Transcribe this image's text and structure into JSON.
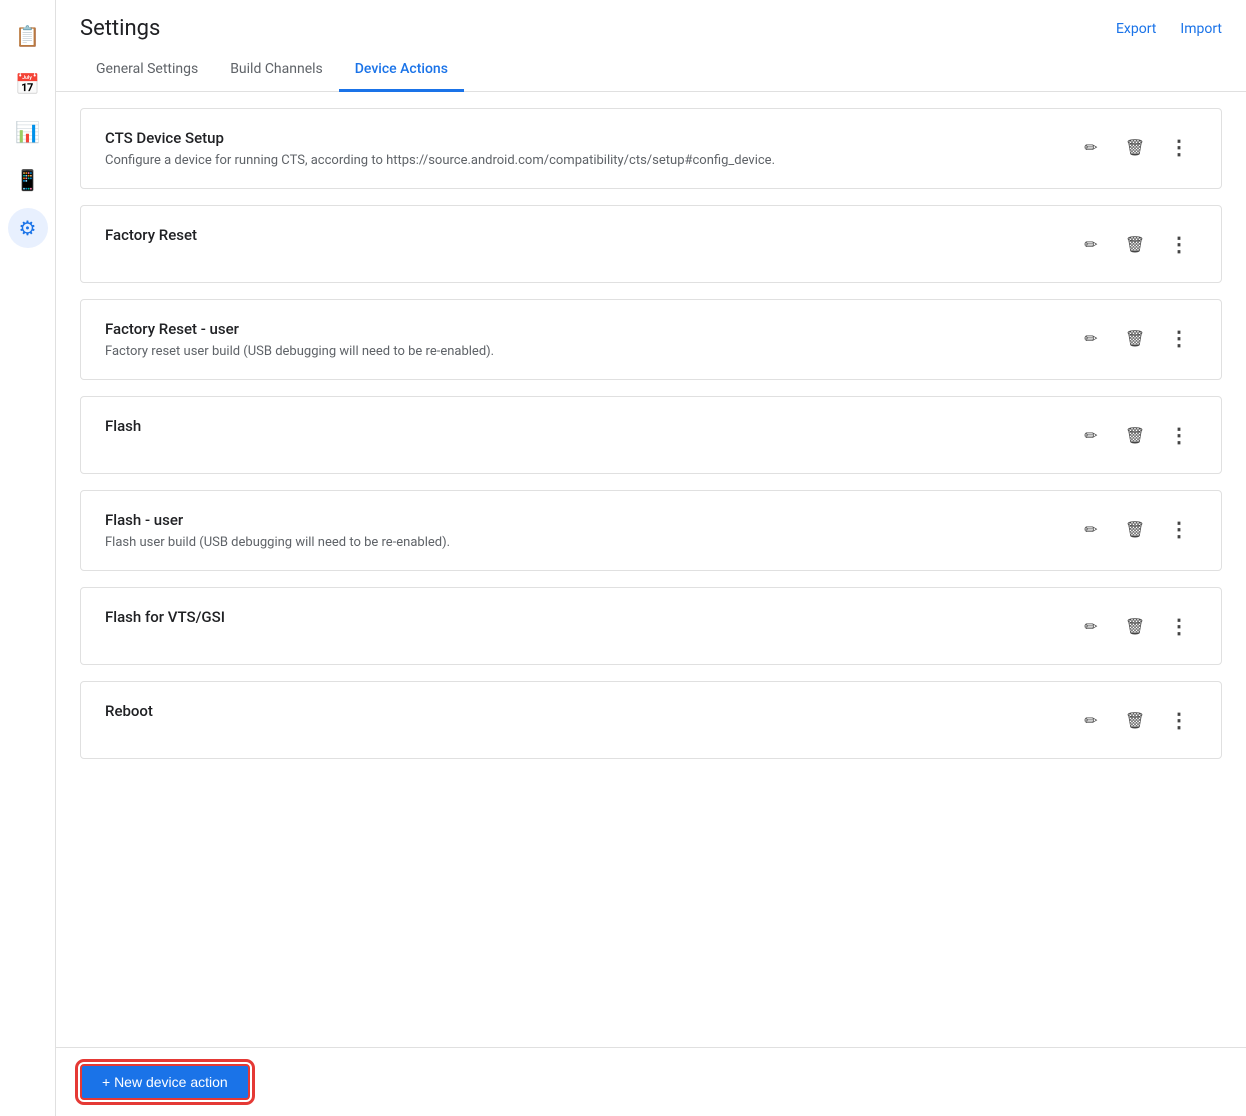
{
  "header": {
    "title": "Settings",
    "export_label": "Export",
    "import_label": "Import"
  },
  "tabs": [
    {
      "id": "general",
      "label": "General Settings",
      "active": false
    },
    {
      "id": "build-channels",
      "label": "Build Channels",
      "active": false
    },
    {
      "id": "device-actions",
      "label": "Device Actions",
      "active": true
    }
  ],
  "sidebar": {
    "items": [
      {
        "id": "reports",
        "icon": "📋",
        "label": "Reports"
      },
      {
        "id": "calendar",
        "icon": "📅",
        "label": "Calendar"
      },
      {
        "id": "analytics",
        "icon": "📊",
        "label": "Analytics"
      },
      {
        "id": "device",
        "icon": "📱",
        "label": "Device"
      },
      {
        "id": "settings",
        "icon": "⚙",
        "label": "Settings",
        "active": true
      }
    ]
  },
  "actions": [
    {
      "id": "cts-device-setup",
      "name": "CTS Device Setup",
      "description": "Configure a device for running CTS, according to https://source.android.com/compatibility/cts/setup#config_device."
    },
    {
      "id": "factory-reset",
      "name": "Factory Reset",
      "description": ""
    },
    {
      "id": "factory-reset-user",
      "name": "Factory Reset - user",
      "description": "Factory reset user build (USB debugging will need to be re-enabled)."
    },
    {
      "id": "flash",
      "name": "Flash",
      "description": ""
    },
    {
      "id": "flash-user",
      "name": "Flash - user",
      "description": "Flash user build (USB debugging will need to be re-enabled)."
    },
    {
      "id": "flash-vts-gsi",
      "name": "Flash for VTS/GSI",
      "description": ""
    },
    {
      "id": "reboot",
      "name": "Reboot",
      "description": ""
    }
  ],
  "footer": {
    "new_action_label": "+ New device action"
  }
}
